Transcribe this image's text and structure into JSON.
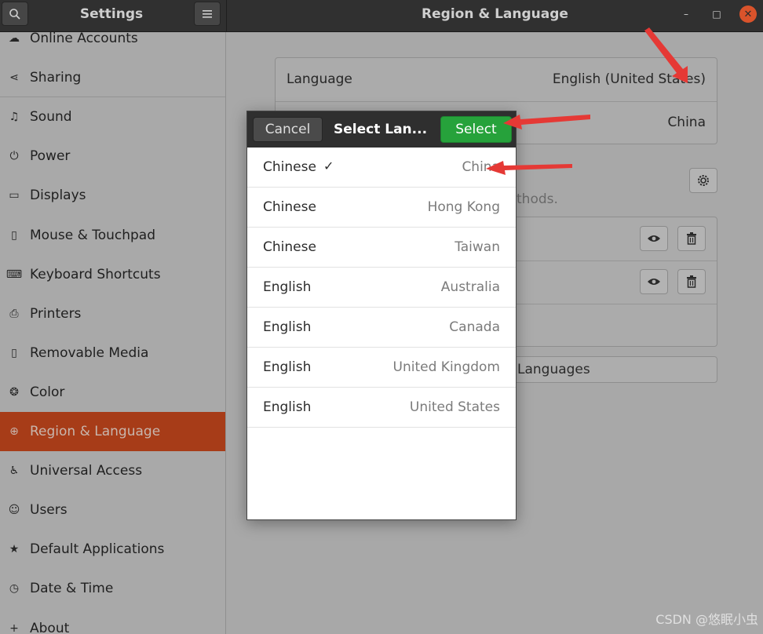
{
  "titlebar": {
    "app_title": "Settings",
    "panel_title": "Region & Language",
    "minimize": "–",
    "maximize": "□",
    "close": "✕"
  },
  "sidebar": {
    "items": [
      {
        "label": "Online Accounts",
        "icon": "online-accounts-icon",
        "glyph": "☁"
      },
      {
        "label": "Sharing",
        "icon": "share-icon",
        "glyph": "⋖"
      },
      {
        "label": "Sound",
        "icon": "music-note-icon",
        "glyph": "♫"
      },
      {
        "label": "Power",
        "icon": "power-icon",
        "glyph": "⏻"
      },
      {
        "label": "Displays",
        "icon": "display-icon",
        "glyph": "▭"
      },
      {
        "label": "Mouse & Touchpad",
        "icon": "mouse-icon",
        "glyph": "▯"
      },
      {
        "label": "Keyboard Shortcuts",
        "icon": "keyboard-icon",
        "glyph": "⌨"
      },
      {
        "label": "Printers",
        "icon": "printer-icon",
        "glyph": "⎙"
      },
      {
        "label": "Removable Media",
        "icon": "usb-drive-icon",
        "glyph": "▯"
      },
      {
        "label": "Color",
        "icon": "color-icon",
        "glyph": "❂"
      },
      {
        "label": "Region & Language",
        "icon": "globe-icon",
        "glyph": "⊕",
        "active": true
      },
      {
        "label": "Universal Access",
        "icon": "accessibility-icon",
        "glyph": "♿"
      },
      {
        "label": "Users",
        "icon": "users-icon",
        "glyph": "☺"
      },
      {
        "label": "Default Applications",
        "icon": "star-icon",
        "glyph": "★"
      },
      {
        "label": "Date & Time",
        "icon": "clock-icon",
        "glyph": "◷"
      },
      {
        "label": "About",
        "icon": "info-icon",
        "glyph": "+"
      }
    ]
  },
  "main": {
    "language_label": "Language",
    "language_value": "English (United States)",
    "formats_value": "China",
    "input_sources_hint": "thods.",
    "manage_languages_label": "Languages"
  },
  "dialog": {
    "cancel_label": "Cancel",
    "title": "Select Lan...",
    "select_label": "Select",
    "selected_check": "✓",
    "languages": [
      {
        "language": "Chinese",
        "region": "China",
        "selected": true
      },
      {
        "language": "Chinese",
        "region": "Hong Kong"
      },
      {
        "language": "Chinese",
        "region": "Taiwan"
      },
      {
        "language": "English",
        "region": "Australia"
      },
      {
        "language": "English",
        "region": "Canada"
      },
      {
        "language": "English",
        "region": "United Kingdom"
      },
      {
        "language": "English",
        "region": "United States"
      }
    ]
  },
  "watermark": "CSDN @悠眠小虫",
  "colors": {
    "accent": "#a73c18",
    "select_button": "#26a23b",
    "close_button": "#d9532b",
    "annotation_arrow": "#e53935"
  }
}
